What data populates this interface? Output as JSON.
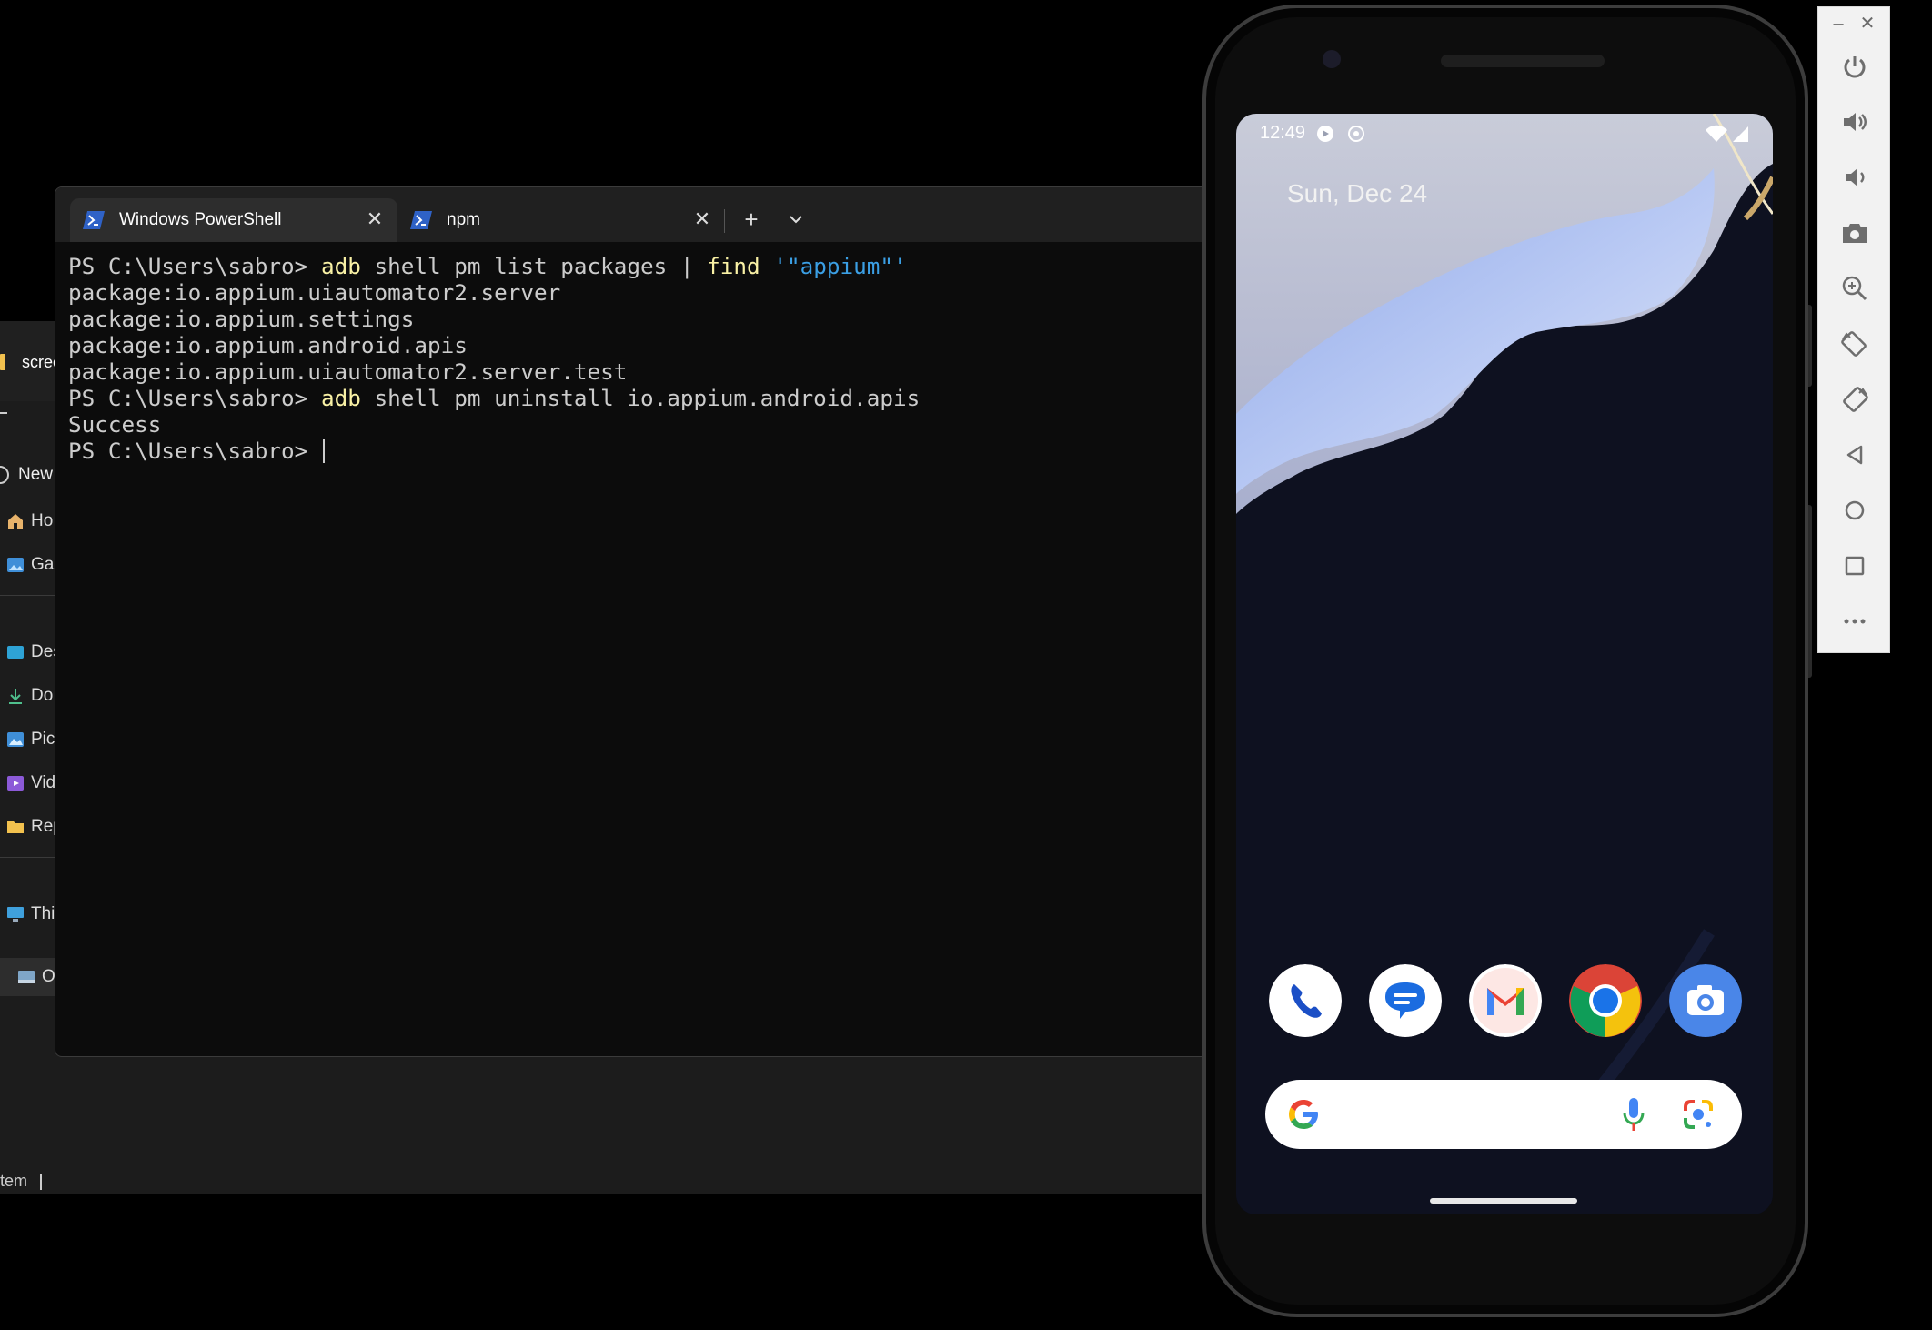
{
  "explorer": {
    "tab_title": "scree",
    "new_button": "New",
    "nav_items": [
      {
        "label": "Ho",
        "icon": "home-icon"
      },
      {
        "label": "Gal",
        "icon": "gallery-icon"
      },
      {
        "label": "Des",
        "icon": "desktop-folder-icon"
      },
      {
        "label": "Do",
        "icon": "downloads-icon"
      },
      {
        "label": "Pict",
        "icon": "pictures-icon"
      },
      {
        "label": "Vid",
        "icon": "videos-icon"
      },
      {
        "label": "Rep",
        "icon": "folder-icon"
      },
      {
        "label": "This",
        "icon": "this-pc-icon"
      },
      {
        "label": "O",
        "icon": "os-drive-icon"
      }
    ],
    "status_text": "tem"
  },
  "terminal": {
    "tabs": [
      {
        "label": "Windows PowerShell",
        "icon": "powershell-icon",
        "active": true
      },
      {
        "label": "npm",
        "icon": "powershell-icon",
        "active": false
      }
    ],
    "new_tab_glyph": "+",
    "dropdown_glyph": "⌄",
    "console": {
      "l1_prompt": "PS C:\\Users\\sabro> ",
      "l1_cmd_a": "adb",
      "l1_text_a": " shell pm list packages | ",
      "l1_cmd_b": "find",
      "l1_text_b": " ",
      "l1_str": "'\"appium\"'",
      "l2": "package:io.appium.uiautomator2.server",
      "l3": "package:io.appium.settings",
      "l4": "package:io.appium.android.apis",
      "l5": "package:io.appium.uiautomator2.server.test",
      "l6_prompt": "PS C:\\Users\\sabro> ",
      "l6_cmd": "adb",
      "l6_text": " shell pm uninstall io.appium.android.apis",
      "l7": "Success",
      "l8_prompt": "PS C:\\Users\\sabro> "
    },
    "colors": {
      "command": "#f9f1a5",
      "string": "#3b9fe4",
      "text": "#cccccc",
      "background": "#0c0c0c"
    }
  },
  "phone": {
    "status_time": "12:49",
    "date": "Sun, Dec 24",
    "dock_apps": [
      "phone-app-icon",
      "messages-app-icon",
      "gmail-app-icon",
      "chrome-app-icon",
      "camera-app-icon"
    ],
    "search_icons": [
      "google-g-icon",
      "microphone-icon",
      "google-lens-icon"
    ]
  },
  "emulator_toolbar": {
    "window_buttons": [
      "–",
      "✕"
    ],
    "tools": [
      "power-icon",
      "volume-up-icon",
      "volume-down-icon",
      "screenshot-icon",
      "zoom-icon",
      "rotate-left-icon",
      "rotate-right-icon",
      "back-icon",
      "home-icon",
      "overview-icon",
      "more-icon"
    ]
  }
}
